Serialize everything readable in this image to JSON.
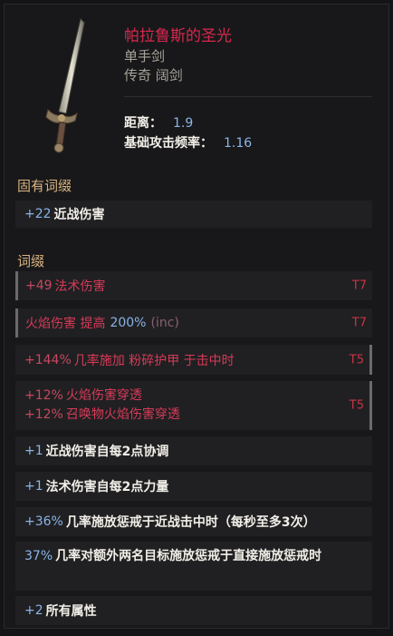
{
  "item": {
    "name": "帕拉鲁斯的圣光",
    "type_line1": "单手剑",
    "type_line2": "传奇 阔剑",
    "stats": [
      {
        "label": "距离：",
        "value": "1.9"
      },
      {
        "label": "基础攻击频率：",
        "value": "1.16"
      }
    ]
  },
  "sections": {
    "implicit_title": "固有词缀",
    "affix_title": "词缀"
  },
  "implicit": [
    {
      "num": "+22",
      "text": "近战伤害"
    }
  ],
  "affixes": [
    {
      "num": "+49",
      "text": "法术伤害",
      "tier": "T7"
    },
    {
      "text": "火焰伤害 提高",
      "num": "200%",
      "suffix": "(inc)",
      "tier": "T7"
    },
    {
      "num": "+144%",
      "text": "几率施加 粉碎护甲 于击中时",
      "tier": "T5"
    },
    {
      "lines": [
        {
          "num": "+12%",
          "text": "火焰伤害穿透"
        },
        {
          "num": "+12%",
          "text": "召唤物火焰伤害穿透"
        }
      ],
      "tier": "T5"
    }
  ],
  "legendary": [
    {
      "num": "+1",
      "text": "近战伤害自每2点协调"
    },
    {
      "num": "+1",
      "text": "法术伤害自每2点力量"
    },
    {
      "num": "+36%",
      "text": "几率施放惩戒于近战击中时（每秒至多3次）"
    },
    {
      "num": "37%",
      "text": "几率对额外两名目标施放惩戒于直接施放惩戒时"
    },
    {
      "num": "+2",
      "text": "所有属性"
    }
  ],
  "colors": {
    "name": "#d6284e",
    "value_blue": "#8ab4e8",
    "affix_red": "#d63a58",
    "section_gold": "#d9b480",
    "tier_red": "#c83444"
  },
  "icons": {
    "weapon": "broadsword-icon"
  }
}
